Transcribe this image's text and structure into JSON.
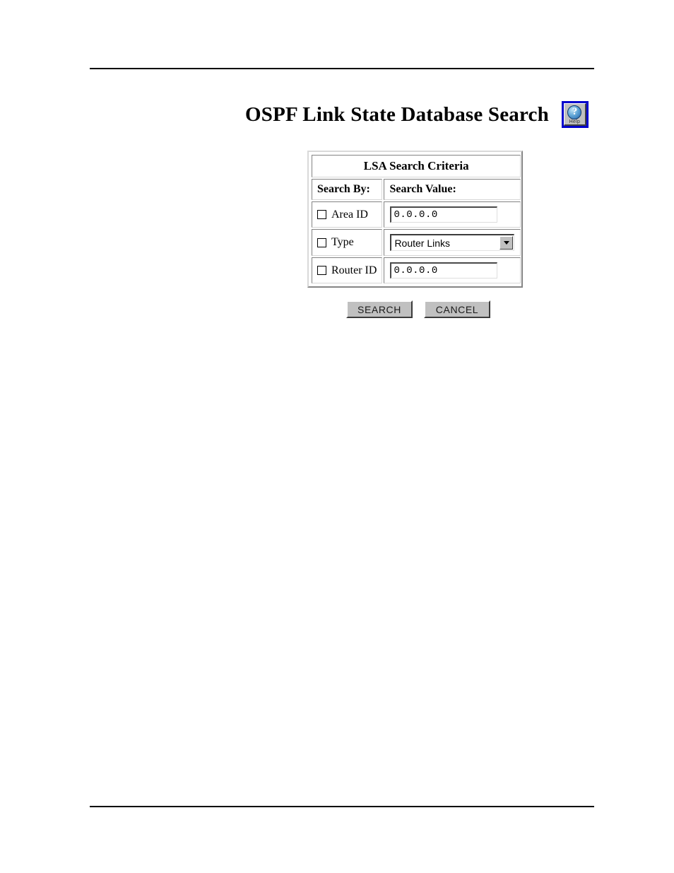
{
  "page": {
    "title": "OSPF Link State Database Search"
  },
  "help": {
    "icon": "question-mark-circle-icon",
    "label": "Help"
  },
  "table": {
    "caption": "LSA Search Criteria",
    "headers": {
      "search_by": "Search By:",
      "search_value": "Search Value:"
    },
    "rows": [
      {
        "checkbox_label": "Area ID",
        "checked": false,
        "control": "text",
        "value": "0.0.0.0"
      },
      {
        "checkbox_label": "Type",
        "checked": false,
        "control": "select",
        "value": "Router Links",
        "options": [
          "Router Links"
        ]
      },
      {
        "checkbox_label": "Router ID",
        "checked": false,
        "control": "text",
        "value": "0.0.0.0"
      }
    ]
  },
  "buttons": {
    "search": "SEARCH",
    "cancel": "CANCEL"
  },
  "colors": {
    "help_border": "#0000cc",
    "button_face": "#c0c0c0",
    "text": "#000000",
    "rule": "#000000"
  }
}
